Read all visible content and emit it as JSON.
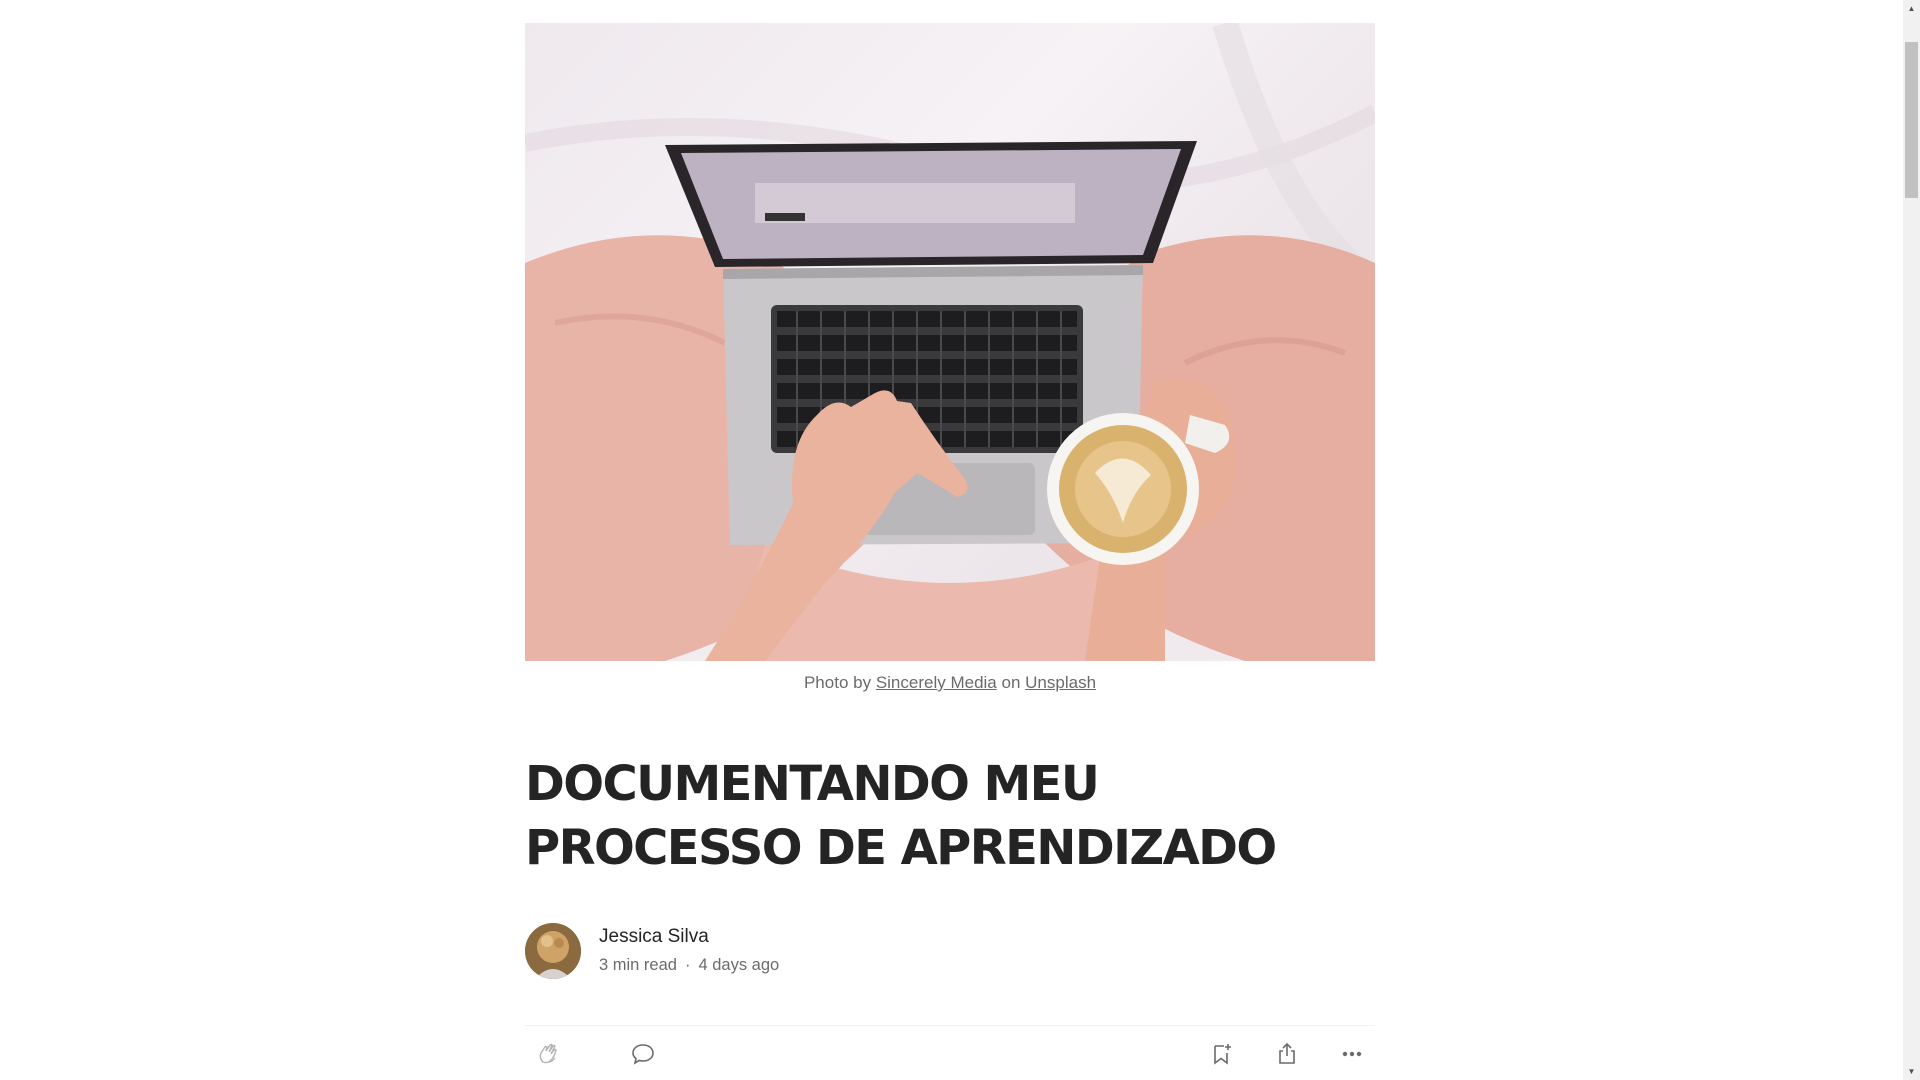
{
  "hero": {
    "icon": "laptop-coffee-photo"
  },
  "caption": {
    "prefix": "Photo by",
    "photographer": "Sincerely Media",
    "joiner": "on",
    "source": "Unsplash"
  },
  "article": {
    "title": "DOCUMENTANDO MEU PROCESSO DE APRENDIZADO"
  },
  "author": {
    "name": "Jessica Silva",
    "read_time": "3 min read",
    "separator": "·",
    "published": "4 days ago"
  },
  "actions": {
    "clap_icon": "clap-icon",
    "response_icon": "comment-icon",
    "save_icon": "bookmark-add-icon",
    "share_icon": "share-icon",
    "more_icon": "more-icon"
  },
  "scrollbar": {
    "up_glyph": "▲",
    "down_glyph": "▼"
  }
}
